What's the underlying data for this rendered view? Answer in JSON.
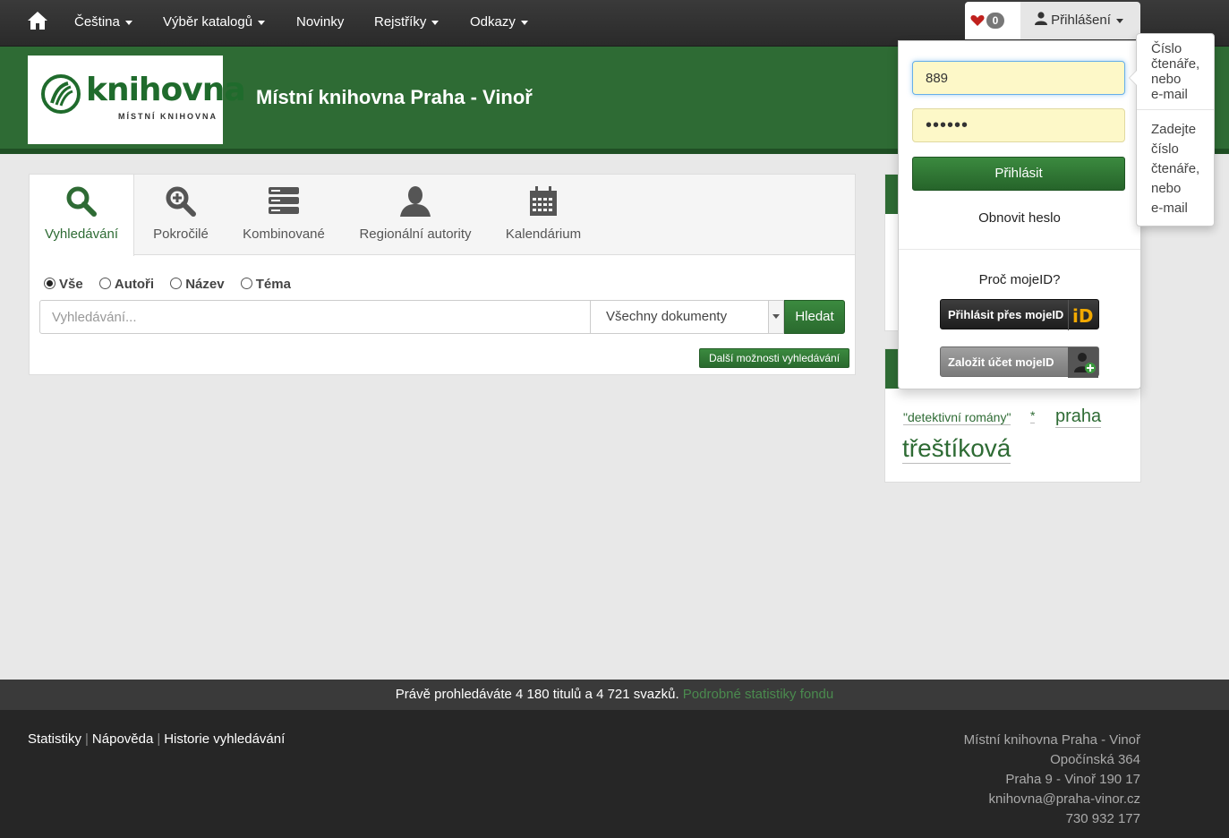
{
  "nav": {
    "language": "Čeština",
    "catalogs": "Výběr katalogů",
    "news": "Novinky",
    "indexes": "Rejstříky",
    "links": "Odkazy",
    "favorites_count": "0",
    "login": "Přihlášení"
  },
  "header": {
    "logo_text": "knihovna",
    "logo_subtext": "MÍSTNÍ KNIHOVNA",
    "title": "Místní knihovna Praha - Vinoř"
  },
  "search": {
    "tabs": [
      {
        "label": "Vyhledávání",
        "icon": "search-icon"
      },
      {
        "label": "Pokročilé",
        "icon": "zoom-in-icon"
      },
      {
        "label": "Kombinované",
        "icon": "stack-icon"
      },
      {
        "label": "Regionální autority",
        "icon": "person-icon"
      },
      {
        "label": "Kalendárium",
        "icon": "calendar-icon"
      }
    ],
    "radios": [
      {
        "label": "Vše",
        "checked": true
      },
      {
        "label": "Autoři",
        "checked": false
      },
      {
        "label": "Název",
        "checked": false
      },
      {
        "label": "Téma",
        "checked": false
      }
    ],
    "placeholder": "Vyhledávání...",
    "doc_type": "Všechny dokumenty",
    "submit": "Hledat",
    "more_options": "Další možnosti vyhledávání"
  },
  "tags": {
    "items": [
      "\"detektivní romány\"",
      "*",
      "praha",
      "třeštíková"
    ]
  },
  "login_dropdown": {
    "username_value": "889",
    "password_value": "••••••",
    "submit": "Přihlásit",
    "reset_password": "Obnovit heslo",
    "why_mojeid": "Proč mojeID?",
    "mojeid_login": "Přihlásit přes mojeID",
    "mojeid_create": "Založit účet mojeID"
  },
  "tooltip": {
    "top_lines": [
      "Číslo",
      "čtenáře,",
      "nebo",
      "e-mail"
    ],
    "bottom_lines": [
      "Zadejte",
      "číslo",
      "čtenáře,",
      "nebo",
      "e-mail"
    ]
  },
  "stats": {
    "text": "Právě prohledáváte 4 180 titulů a 4 721 svazků.",
    "link": "Podrobné statistiky fondu"
  },
  "footer": {
    "links": [
      "Statistiky",
      "Nápověda",
      "Historie vyhledávání"
    ],
    "address": [
      "Místní knihovna Praha - Vinoř",
      "Opočínská 364",
      "Praha 9 - Vinoř 190 17",
      "knihovna@praha-vinor.cz",
      "730 932 177"
    ]
  },
  "colors": {
    "brand_green": "#2e6b34",
    "navbar": "#2f2f2f",
    "footer": "#262626"
  }
}
